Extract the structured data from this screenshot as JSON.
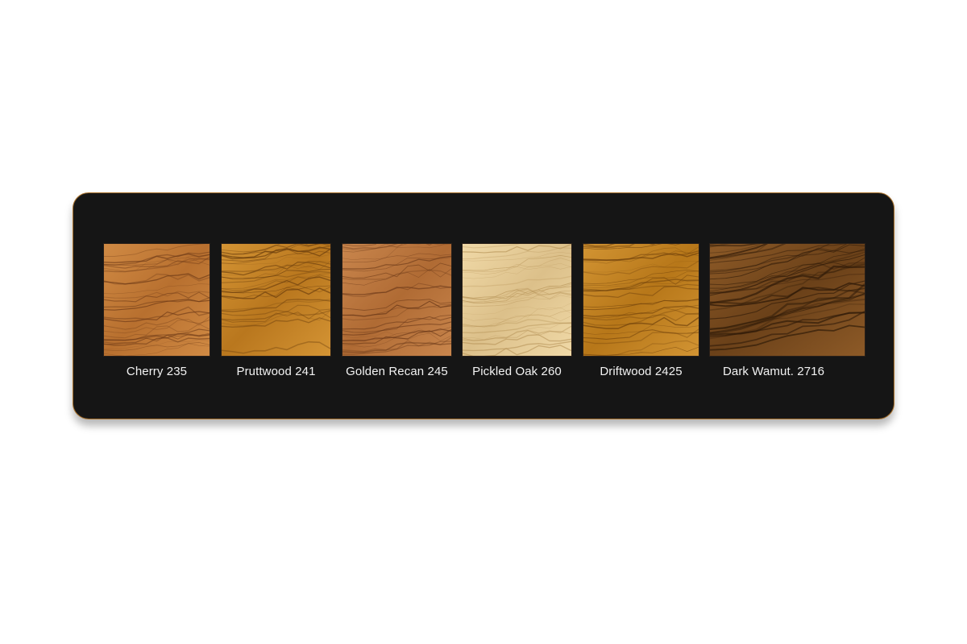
{
  "swatches": [
    {
      "label": "Cherry 235",
      "base_color": "#b8702f",
      "grain_color": "#6e3a17",
      "light_color": "#d08a44"
    },
    {
      "label": "Pruttwood 241",
      "base_color": "#b9771e",
      "grain_color": "#6b3e0d",
      "light_color": "#d49434"
    },
    {
      "label": "Golden Recan 245",
      "base_color": "#b06b34",
      "grain_color": "#6a3818",
      "light_color": "#c9864d"
    },
    {
      "label": "Pickled Oak 260",
      "base_color": "#dcc08a",
      "grain_color": "#b8955a",
      "light_color": "#f0d9a7"
    },
    {
      "label": "Driftwood 2425",
      "base_color": "#b77719",
      "grain_color": "#6a3d0a",
      "light_color": "#d29433"
    },
    {
      "label": "Dark Wamut. 2716",
      "base_color": "#6b4119",
      "grain_color": "#2e1a08",
      "light_color": "#8d5a27"
    }
  ]
}
